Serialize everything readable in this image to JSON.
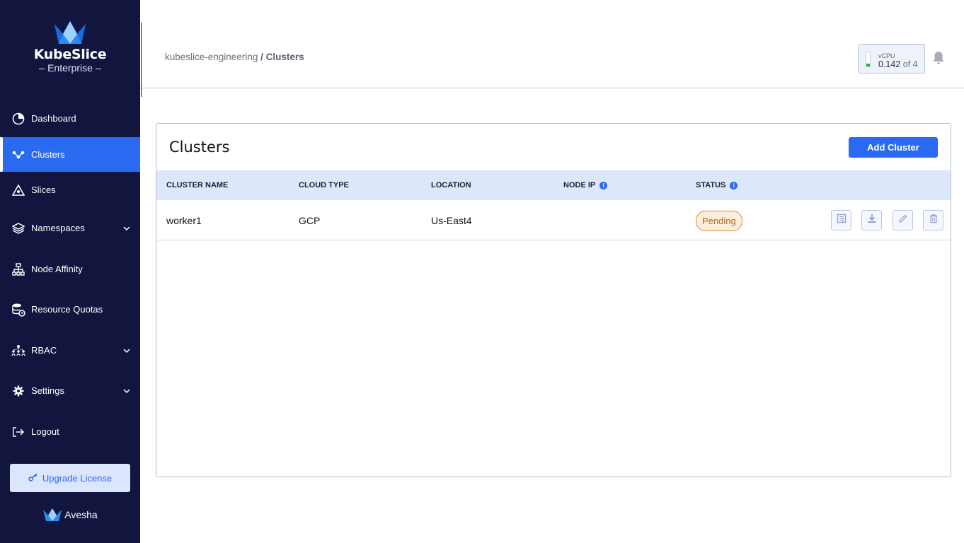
{
  "app": {
    "brand": "KubeSlice",
    "edition": "Enterprise",
    "footer_brand": "Avesha"
  },
  "sidebar": {
    "items": [
      {
        "label": "Dashboard",
        "icon": "pie-chart-icon"
      },
      {
        "label": "Clusters",
        "icon": "cluster-nodes-icon",
        "active": true
      },
      {
        "label": "Slices",
        "icon": "slice-icon"
      },
      {
        "label": "Namespaces",
        "icon": "layers-icon",
        "expandable": true
      },
      {
        "label": "Node Affinity",
        "icon": "hierarchy-icon"
      },
      {
        "label": "Resource Quotas",
        "icon": "database-clock-icon"
      },
      {
        "label": "RBAC",
        "icon": "users-network-icon",
        "expandable": true
      },
      {
        "label": "Settings",
        "icon": "gear-icon",
        "expandable": true
      },
      {
        "label": "Logout",
        "icon": "logout-icon"
      }
    ],
    "upgrade_label": "Upgrade License"
  },
  "header": {
    "breadcrumb_project": "kubeslice-engineering",
    "breadcrumb_separator": " / ",
    "breadcrumb_current": "Clusters",
    "vcpu_label": "vCPU",
    "vcpu_used": "0.142",
    "vcpu_of": "of 4",
    "vcpu_fraction": 0.0355
  },
  "main": {
    "title": "Clusters",
    "add_button": "Add Cluster",
    "columns": [
      "CLUSTER NAME",
      "CLOUD TYPE",
      "LOCATION",
      "NODE IP",
      "STATUS"
    ],
    "rows": [
      {
        "name": "worker1",
        "cloud": "GCP",
        "location": "Us-East4",
        "node_ip": "",
        "status": "Pending"
      }
    ]
  },
  "colors": {
    "sidebar_bg": "#12163f",
    "accent": "#2a6af0",
    "pending": "#e08a2e"
  }
}
